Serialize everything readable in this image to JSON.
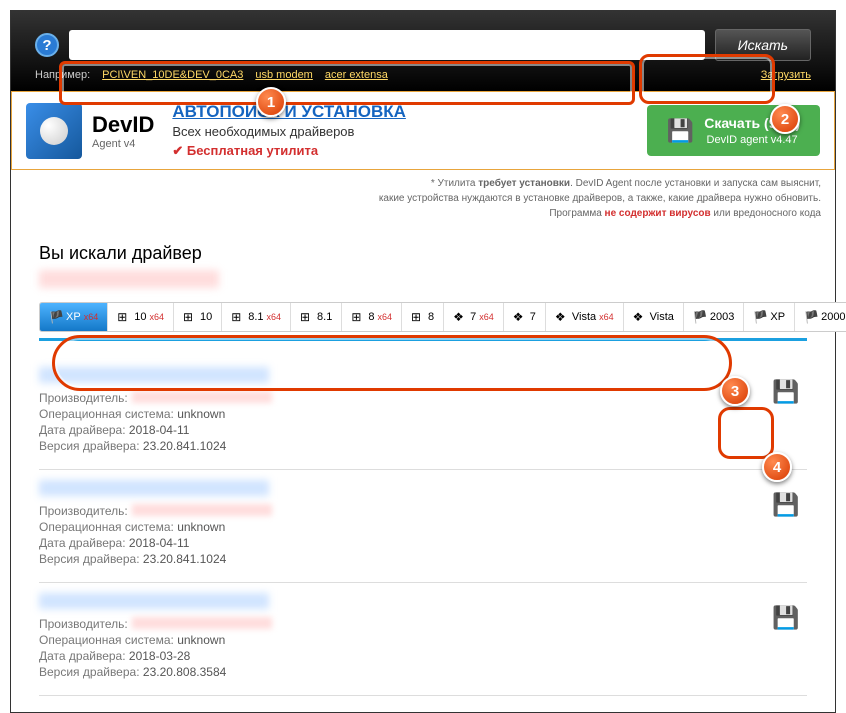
{
  "topbar": {
    "search_placeholder": "",
    "search_value": "",
    "search_button": "Искать",
    "example_label": "Например:",
    "example_links": [
      "PCI\\VEN_10DE&DEV_0CA3",
      "usb modem",
      "acer extensa"
    ],
    "load_link": "Загрузить"
  },
  "promo": {
    "brand_bold": "Dev",
    "brand_rest": "ID",
    "agent": "Agent v4",
    "headline": "АВТОПОИСК И УСТАНОВКА",
    "subline": "Всех необходимых драйверов",
    "free": "Бесплатная утилита",
    "download_title": "Скачать (9мб)",
    "download_sub": "DevID agent v4.47"
  },
  "note": {
    "line1_pre": "* Утилита ",
    "line1_bold": "требует установки",
    "line1_post": ". DevID Agent после установки и запуска сам выяснит,",
    "line2": "какие устройства нуждаются в установке драйверов, а также, какие драйвера нужно обновить.",
    "line3_pre": "Программа ",
    "line3_bold": "не содержит вирусов",
    "line3_post": " или вредоносного кода"
  },
  "content": {
    "heading": "Вы искали драйвер"
  },
  "os_tabs": [
    {
      "label": "XP",
      "x64": true,
      "active": true,
      "flag": "🏴"
    },
    {
      "label": "10",
      "x64": true,
      "flag": "⊞"
    },
    {
      "label": "10",
      "flag": "⊞"
    },
    {
      "label": "8.1",
      "x64": true,
      "flag": "⊞"
    },
    {
      "label": "8.1",
      "flag": "⊞"
    },
    {
      "label": "8",
      "x64": true,
      "flag": "⊞"
    },
    {
      "label": "8",
      "flag": "⊞"
    },
    {
      "label": "7",
      "x64": true,
      "flag": "❖"
    },
    {
      "label": "7",
      "flag": "❖"
    },
    {
      "label": "Vista",
      "x64": true,
      "flag": "❖"
    },
    {
      "label": "Vista",
      "flag": "❖"
    },
    {
      "label": "2003",
      "flag": "🏴"
    },
    {
      "label": "XP",
      "flag": "🏴"
    },
    {
      "label": "2000",
      "flag": "🏴"
    }
  ],
  "labels": {
    "manufacturer": "Производитель:",
    "os": "Операционная система:",
    "date": "Дата драйвера:",
    "version": "Версия драйвера:"
  },
  "results": [
    {
      "os": "unknown",
      "date": "2018-04-11",
      "version": "23.20.841.1024"
    },
    {
      "os": "unknown",
      "date": "2018-04-11",
      "version": "23.20.841.1024"
    },
    {
      "os": "unknown",
      "date": "2018-03-28",
      "version": "23.20.808.3584"
    }
  ]
}
